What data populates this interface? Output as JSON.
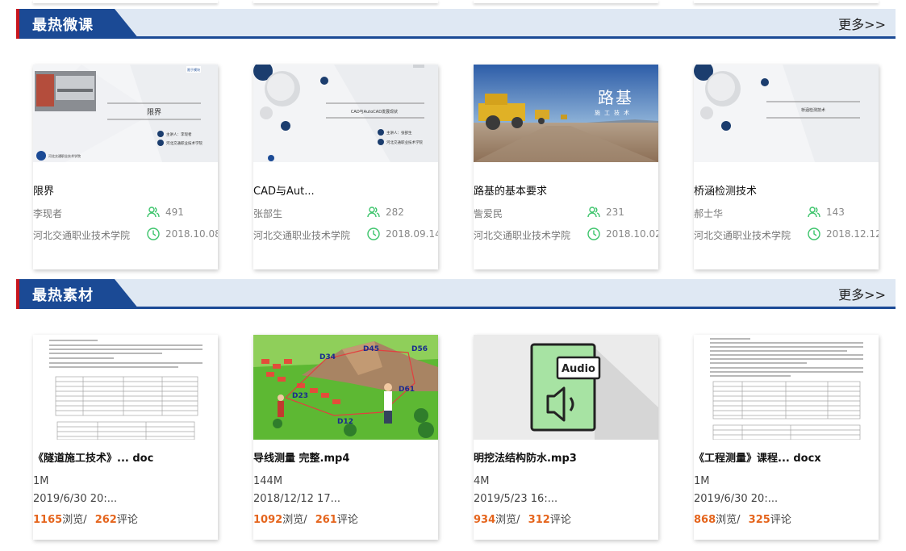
{
  "sections": {
    "micro": {
      "title": "最热微课",
      "more": "更多>>"
    },
    "materials": {
      "title": "最热素材",
      "more": "更多>>"
    }
  },
  "micro_courses": [
    {
      "name": "限界",
      "author": "李现者",
      "school": "河北交通职业技术学院",
      "views": "491",
      "date": "2018.10.08",
      "thumb_title": "限界",
      "thumb_presenter": "主讲人：李现者",
      "thumb_school": "河北交通职业技术学院",
      "thumb_corner": "限于模块"
    },
    {
      "name": "CAD与Aut...",
      "author": "张部生",
      "school": "河北交通职业技术学院",
      "views": "282",
      "date": "2018.09.14",
      "thumb_title": "CAD与AutoCAD发展现状",
      "thumb_presenter": "主讲人：张部生",
      "thumb_school": "河北交通职业技术学院"
    },
    {
      "name": "路基的基本要求",
      "author": "訾爱民",
      "school": "河北交通职业技术学院",
      "views": "231",
      "date": "2018.10.02",
      "thumb_title": "路基",
      "thumb_sub": "施工技术"
    },
    {
      "name": "桥涵检测技术",
      "author": "郝士华",
      "school": "河北交通职业技术学院",
      "views": "143",
      "date": "2018.12.12",
      "thumb_title": "桥涵检测技术"
    }
  ],
  "materials": [
    {
      "name": "《隧道施工技术》... doc",
      "size": "1M",
      "date": "2019/6/30 20:...",
      "views": "1165",
      "views_label": "浏览/",
      "comments": "262",
      "comments_label": "评论"
    },
    {
      "name": "导线测量 完整.mp4",
      "size": "144M",
      "date": "2018/12/12 17...",
      "views": "1092",
      "views_label": "浏览/",
      "comments": "261",
      "comments_label": "评论",
      "map_labels": [
        "D34",
        "D45",
        "D56",
        "D23",
        "D61",
        "D12"
      ]
    },
    {
      "name": "明挖法结构防水.mp3",
      "size": "4M",
      "date": "2019/5/23 16:...",
      "views": "934",
      "views_label": "浏览/",
      "comments": "312",
      "comments_label": "评论",
      "audio_label": "Audio"
    },
    {
      "name": "《工程测量》课程... docx",
      "size": "1M",
      "date": "2019/6/30 20:...",
      "views": "868",
      "views_label": "浏览/",
      "comments": "325",
      "comments_label": "评论"
    }
  ],
  "colors": {
    "brand_blue": "#1b4a95",
    "accent_red": "#c8161d",
    "number_orange": "#e5651d",
    "icon_green": "#3cc46b"
  }
}
